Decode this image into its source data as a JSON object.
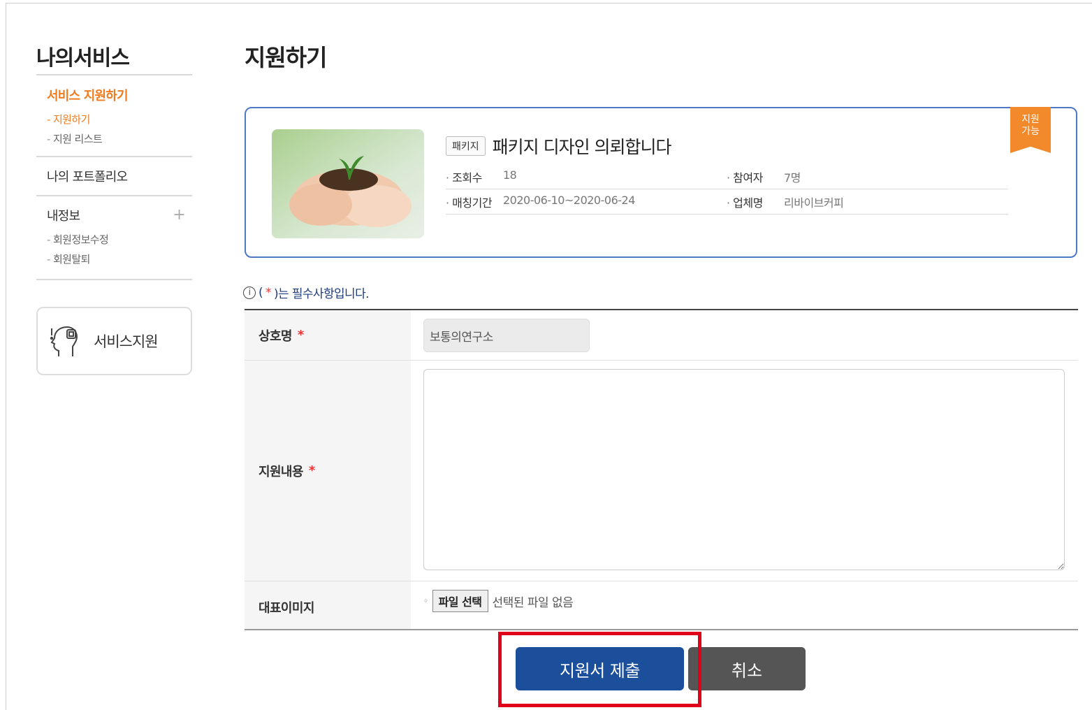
{
  "sidebar": {
    "title": "나의서비스",
    "groups": [
      {
        "label": "서비스 지원하기",
        "items": [
          {
            "label": "지원하기"
          },
          {
            "label": "지원 리스트"
          }
        ]
      },
      {
        "label": "나의 포트폴리오"
      },
      {
        "label": "내정보",
        "items": [
          {
            "label": "회원정보수정"
          },
          {
            "label": "회원탈퇴"
          }
        ]
      }
    ],
    "service_box": {
      "label": "서비스지원",
      "icon": "head-gear-icon"
    },
    "plus_symbol": "+"
  },
  "main": {
    "title": "지원하기",
    "card": {
      "badge": "지원\n가능",
      "tag": "패키지",
      "title": "패키지 디자인 의뢰합니다",
      "views_label": "조회수",
      "views": "18",
      "participants_label": "참여자",
      "participants": "7명",
      "period_label": "매칭기간",
      "period": "2020-06-10~2020-06-24",
      "company_label": "업체명",
      "company": "리바이브커피"
    },
    "required_note": {
      "icon": "i",
      "prefix": "(",
      "star": "*",
      "suffix": ")는 필수사항입니다."
    },
    "form": {
      "company_label": "상호명",
      "company_value": "보통의연구소",
      "content_label": "지원내용",
      "content_value": "",
      "image_label": "대표이미지",
      "file_bullet": "◦",
      "file_button": "파일 선택",
      "file_status": "선택된 파일 없음",
      "required_mark": "*"
    },
    "buttons": {
      "submit": "지원서 제출",
      "cancel": "취소"
    }
  },
  "colors": {
    "accent": "#f07c20",
    "primary": "#1b4f9c",
    "card_border": "#4d78c2",
    "highlight": "#e0001b"
  }
}
